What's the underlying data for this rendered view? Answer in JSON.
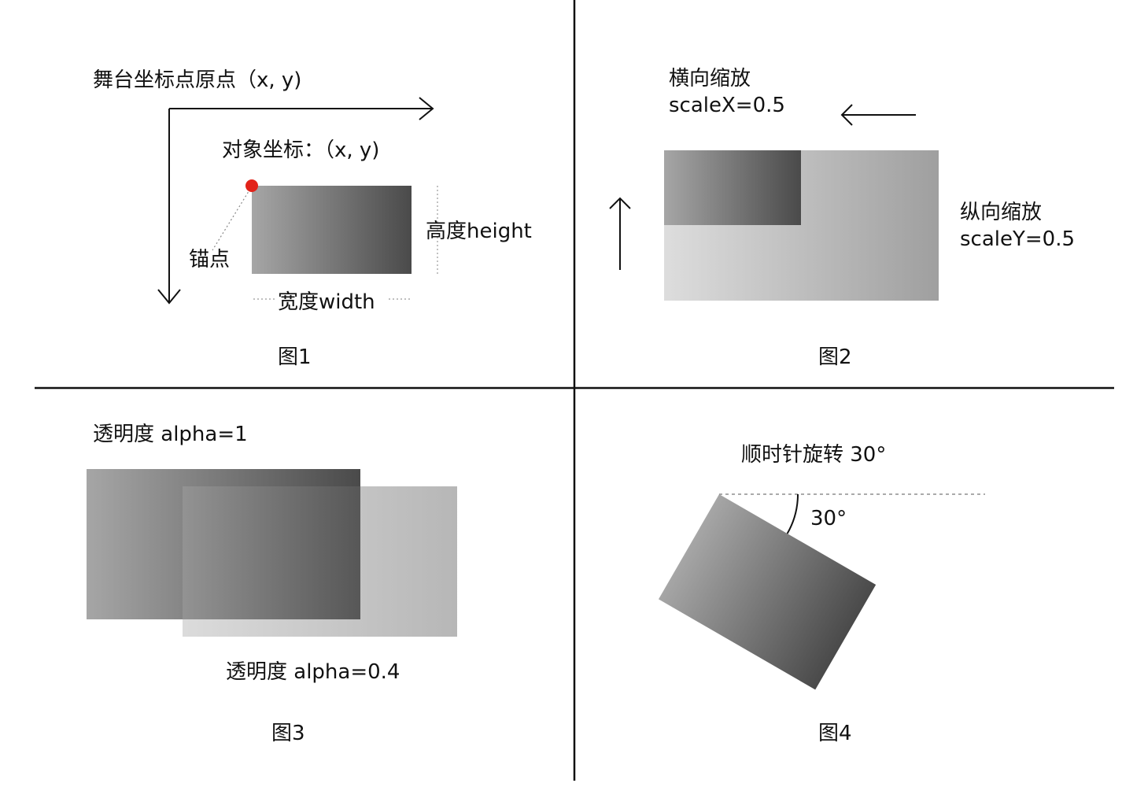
{
  "colors": {
    "line": "#111111",
    "anchor_dot": "#e2231a",
    "gradient_light": "#a6a6a6",
    "gradient_dark": "#4a4a4a",
    "scaled_light": "#dddddd",
    "scaled_dark": "#9f9f9f"
  },
  "fig1": {
    "stage_origin_label": "舞台坐标点原点（x, y)",
    "object_coord_label": "对象坐标：（x, y)",
    "anchor_label": "锚点",
    "height_label": "高度height",
    "width_label": "宽度width",
    "caption": "图1"
  },
  "fig2": {
    "scale_x_title": "横向缩放",
    "scale_x_value": "scaleX=0.5",
    "scale_y_title": "纵向缩放",
    "scale_y_value": "scaleY=0.5",
    "caption": "图2"
  },
  "fig3": {
    "alpha_1_label": "透明度 alpha=1",
    "alpha_04_label": "透明度 alpha=0.4",
    "caption": "图3"
  },
  "fig4": {
    "rotation_label": "顺时针旋转 30°",
    "angle_label": "30°",
    "caption": "图4"
  }
}
